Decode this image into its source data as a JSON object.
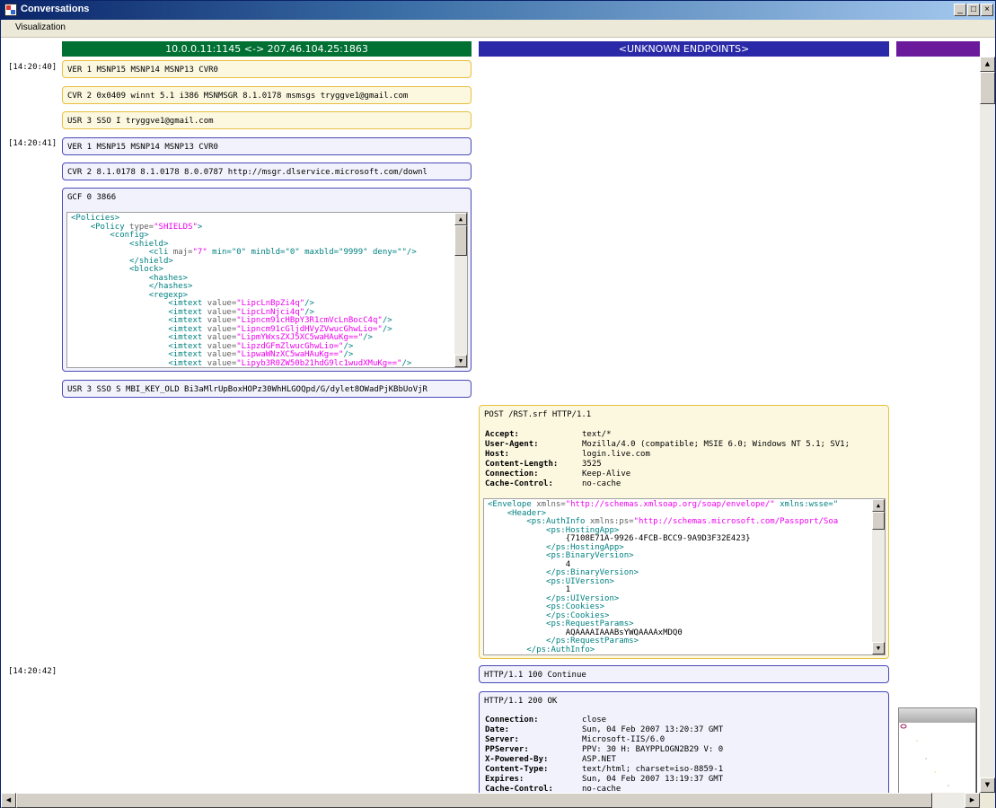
{
  "window": {
    "title": "Conversations",
    "min": "_",
    "max": "□",
    "close": "×"
  },
  "menu": {
    "visualization": "Visualization"
  },
  "headers": {
    "conn1": "10.0.0.11:1145 <-> 207.46.104.25:1863",
    "conn2": "<UNKNOWN ENDPOINTS>",
    "conn1_color": "#007033",
    "conn2_color": "#2a2aa8",
    "conn3_color": "#6a1a9a"
  },
  "timestamps": [
    "[14:20:40]",
    "[14:20:41]",
    "[14:20:42]"
  ],
  "messages": {
    "m1": "VER 1 MSNP15 MSNP14 MSNP13 CVR0",
    "m2": "CVR 2 0x0409 winnt 5.1 i386 MSNMSGR 8.1.0178 msmsgs tryggve1@gmail.com",
    "m3": "USR 3 SSO I tryggve1@gmail.com",
    "m4": "VER 1 MSNP15 MSNP14 MSNP13 CVR0",
    "m5": "CVR 2 8.1.0178 8.1.0178 8.0.0787 http://msgr.dlservice.microsoft.com/downl",
    "m6": "GCF 0 3866",
    "m7": "USR 3 SSO S MBI_KEY_OLD Bi3aMlrUpBoxHOPz30WhHLGOQpd/G/dylet8OWadPjKBbUoVjR",
    "post": "POST /RST.srf HTTP/1.1",
    "cont": "HTTP/1.1 100 Continue",
    "ok": "HTTP/1.1 200 OK"
  },
  "policy_xml": [
    {
      "i": 0,
      "tag": "<Policies>"
    },
    {
      "i": 1,
      "tag": "<Policy ",
      "attr": "type=",
      "val": "\"SHIELDS\"",
      "end": ">"
    },
    {
      "i": 2,
      "tag": "<config>"
    },
    {
      "i": 3,
      "tag": "<shield>"
    },
    {
      "i": 4,
      "tag": "<cli ",
      "attr": "maj=",
      "val": "\"7\"",
      "rest": " min=\"0\" minbld=\"0\" maxbld=\"9999\" deny=\"\"/>"
    },
    {
      "i": 3,
      "tag": "</shield>"
    },
    {
      "i": 3,
      "tag": "<block>"
    },
    {
      "i": 4,
      "tag": "<hashes>"
    },
    {
      "i": 4,
      "tag": "</hashes>"
    },
    {
      "i": 4,
      "tag": "<regexp>"
    },
    {
      "i": 5,
      "tag": "<imtext ",
      "attr": "value=",
      "val": "\"LipcLnBpZi4q\"",
      "end": "/>"
    },
    {
      "i": 5,
      "tag": "<imtext ",
      "attr": "value=",
      "val": "\"LipcLnNjci4q\"",
      "end": "/>"
    },
    {
      "i": 5,
      "tag": "<imtext ",
      "attr": "value=",
      "val": "\"Lipncm91cHBpY3R1cmVcLnBocC4q\"",
      "end": "/>"
    },
    {
      "i": 5,
      "tag": "<imtext ",
      "attr": "value=",
      "val": "\"Lipncm91cGljdHVyZVwucGhwLio=\"",
      "end": "/>"
    },
    {
      "i": 5,
      "tag": "<imtext ",
      "attr": "value=",
      "val": "\"LipmYWxsZXJ5XC5waHAuKg==\"",
      "end": "/>"
    },
    {
      "i": 5,
      "tag": "<imtext ",
      "attr": "value=",
      "val": "\"LipzdGFmZlwucGhwLio=\"",
      "end": "/>"
    },
    {
      "i": 5,
      "tag": "<imtext ",
      "attr": "value=",
      "val": "\"LipwaWNzXC5waHAuKg==\"",
      "end": "/>"
    },
    {
      "i": 5,
      "tag": "<imtext ",
      "attr": "value=",
      "val": "\"Lipyb3R0ZW50b21hdG9lc1wudXMuKg==\"",
      "end": "/>"
    }
  ],
  "post_headers": [
    {
      "k": "Accept:",
      "v": "text/*"
    },
    {
      "k": "User-Agent:",
      "v": "Mozilla/4.0 (compatible; MSIE 6.0; Windows NT 5.1; SV1;"
    },
    {
      "k": "Host:",
      "v": "login.live.com"
    },
    {
      "k": "Content-Length:",
      "v": "3525"
    },
    {
      "k": "Connection:",
      "v": "Keep-Alive"
    },
    {
      "k": "Cache-Control:",
      "v": "no-cache"
    }
  ],
  "soap_xml": [
    {
      "i": 0,
      "tag": "<Envelope ",
      "attr": "xmlns=",
      "val": "\"http://schemas.xmlsoap.org/soap/envelope/\"",
      "rest": " xmlns:wsse=\""
    },
    {
      "i": 1,
      "tag": "<Header>"
    },
    {
      "i": 2,
      "tag": "<ps:AuthInfo ",
      "attr": "xmlns:ps=",
      "val": "\"http://schemas.microsoft.com/Passport/Soa"
    },
    {
      "i": 3,
      "tag": "<ps:HostingApp>"
    },
    {
      "i": 4,
      "text": "{7108E71A-9926-4FCB-BCC9-9A9D3F32E423}"
    },
    {
      "i": 3,
      "tag": "</ps:HostingApp>"
    },
    {
      "i": 3,
      "tag": "<ps:BinaryVersion>"
    },
    {
      "i": 4,
      "text": "4"
    },
    {
      "i": 3,
      "tag": "</ps:BinaryVersion>"
    },
    {
      "i": 3,
      "tag": "<ps:UIVersion>"
    },
    {
      "i": 4,
      "text": "1"
    },
    {
      "i": 3,
      "tag": "</ps:UIVersion>"
    },
    {
      "i": 3,
      "tag": "<ps:Cookies>"
    },
    {
      "i": 3,
      "tag": "</ps:Cookies>"
    },
    {
      "i": 3,
      "tag": "<ps:RequestParams>"
    },
    {
      "i": 4,
      "text": "AQAAAAIAAABsYWQAAAAxMDQ0"
    },
    {
      "i": 3,
      "tag": "</ps:RequestParams>"
    },
    {
      "i": 2,
      "tag": "</ps:AuthInfo>"
    }
  ],
  "ok_headers": [
    {
      "k": "Connection:",
      "v": "close"
    },
    {
      "k": "Date:",
      "v": "Sun, 04 Feb 2007 13:20:37 GMT"
    },
    {
      "k": "Server:",
      "v": "Microsoft-IIS/6.0"
    },
    {
      "k": "PPServer:",
      "v": "PPV: 30 H: BAYPPLOGN2B29 V: 0"
    },
    {
      "k": "X-Powered-By:",
      "v": "ASP.NET"
    },
    {
      "k": "Content-Type:",
      "v": "text/html; charset=iso-8859-1"
    },
    {
      "k": "Expires:",
      "v": "Sun, 04 Feb 2007 13:19:37 GMT"
    },
    {
      "k": "Cache-Control:",
      "v": "no-cache"
    }
  ]
}
